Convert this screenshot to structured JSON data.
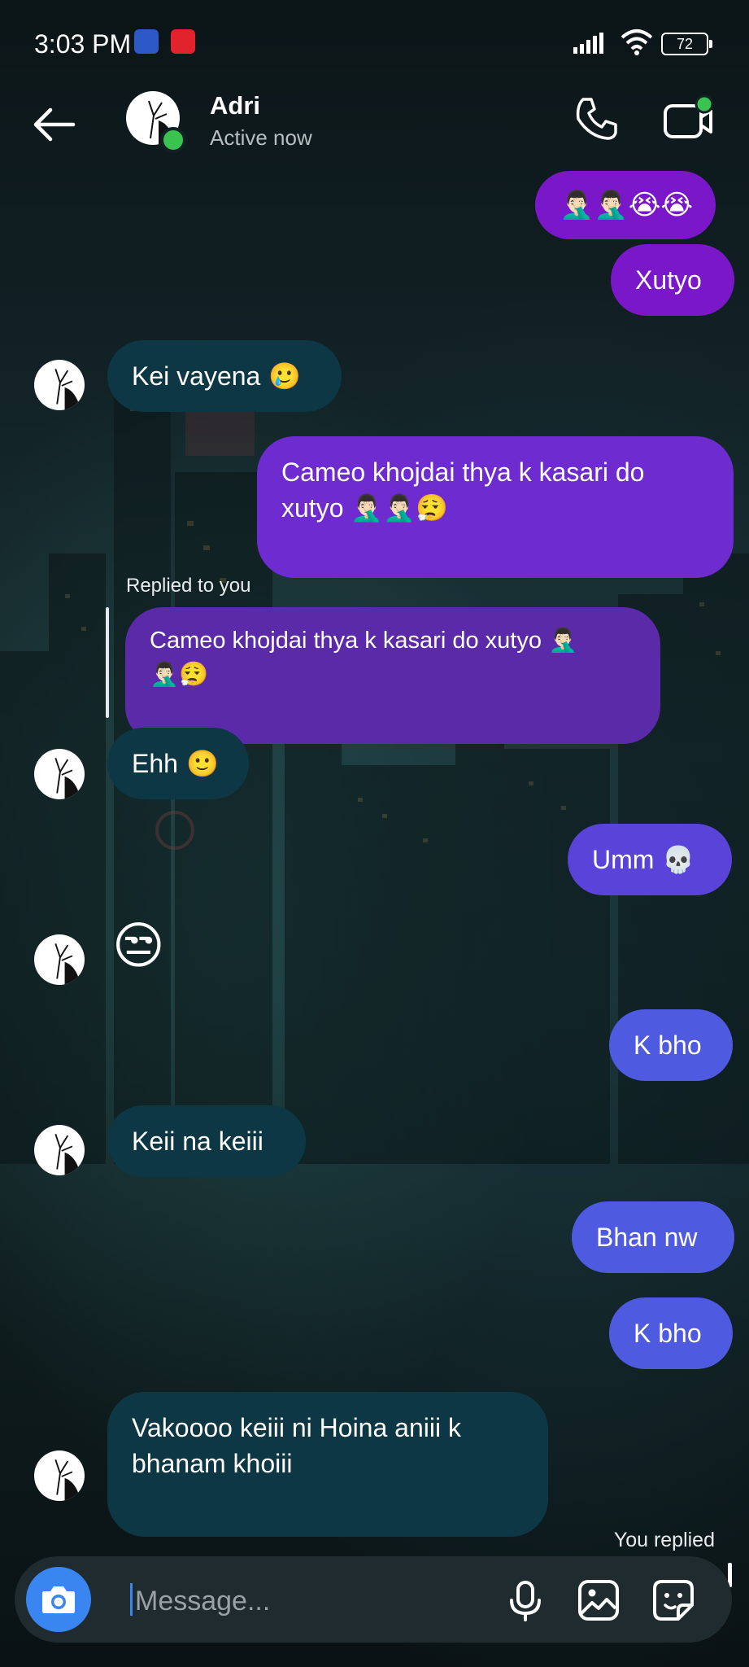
{
  "status_bar": {
    "time": "3:03 PM",
    "battery": "72"
  },
  "header": {
    "contact_name": "Adri",
    "contact_status": "Active now",
    "icons": [
      "back-arrow-icon",
      "phone-icon",
      "video-call-icon"
    ]
  },
  "messages": [
    {
      "id": "m1",
      "dir": "out",
      "text": "",
      "emojis": [
        "man-facepalming",
        "man-facepalming",
        "loudly-crying-face",
        "loudly-crying-face"
      ]
    },
    {
      "id": "m2",
      "dir": "out",
      "text": "Xutyo"
    },
    {
      "id": "m3",
      "dir": "in",
      "text": "Kei vayena",
      "emojis": [
        "smiling-face-with-tear"
      ]
    },
    {
      "id": "m4",
      "dir": "out",
      "text_line1": "Cameo khojdai thya k kasari do",
      "text_line2": "xutyo",
      "emojis": [
        "man-facepalming",
        "man-facepalming",
        "face-exhaling"
      ]
    },
    {
      "id": "m5",
      "dir": "in",
      "reply_label": "Replied to you",
      "quoted_line1": "Cameo khojdai thya k kasari do xutyo",
      "emojis": [
        "man-facepalming",
        "man-facepalming",
        "face-exhaling"
      ]
    },
    {
      "id": "m6",
      "dir": "in",
      "text": "Ehh",
      "emojis": [
        "slightly-smiling-face"
      ]
    },
    {
      "id": "m7",
      "dir": "out",
      "text": "Umm",
      "emojis": [
        "skull"
      ]
    },
    {
      "id": "m8",
      "dir": "in",
      "emojis": [
        "unamused-face"
      ]
    },
    {
      "id": "m9",
      "dir": "out",
      "text": "K bho"
    },
    {
      "id": "m10",
      "dir": "in",
      "text": "Keii na keiii"
    },
    {
      "id": "m11",
      "dir": "out",
      "text": "Bhan nw"
    },
    {
      "id": "m12",
      "dir": "out",
      "text": "K bho"
    },
    {
      "id": "m13",
      "dir": "in",
      "text_line1": "Vakoooo keiii ni Hoina aniii k",
      "text_line2": "bhanam khoiii"
    }
  ],
  "footer_note": "You replied",
  "composer": {
    "placeholder": "Message...",
    "icons": [
      "camera-icon",
      "microphone-icon",
      "gallery-icon",
      "sticker-icon"
    ]
  },
  "colors": {
    "incoming_bubble": "#0d3744",
    "outgoing_top": "#7a17c8",
    "outgoing_bottom": "#4e5ae0",
    "accent": "#3a86f0",
    "online": "#3ac34e"
  }
}
